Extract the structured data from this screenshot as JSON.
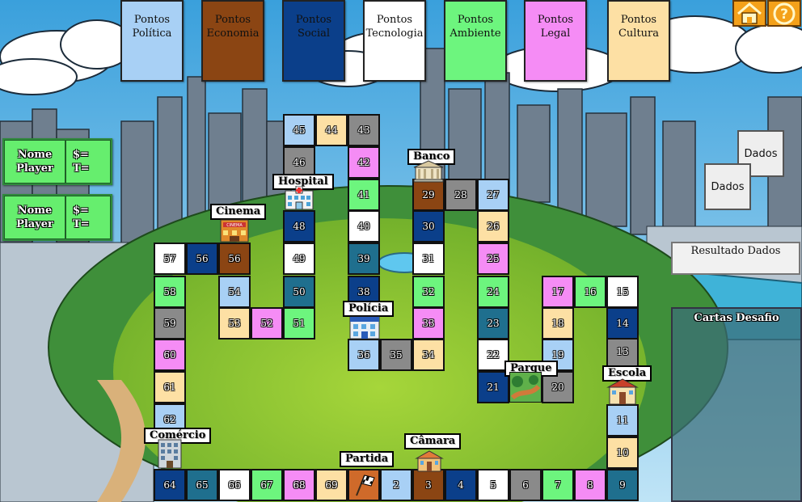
{
  "colors": {
    "politica": "#a8d0f5",
    "economia": "#8b4513",
    "social": "#0b3f8a",
    "tecnologia": "#ffffff",
    "ambiente": "#6df57e",
    "legal": "#f58cf5",
    "cultura": "#fde0a4",
    "button": "#f4a11a",
    "player": "#66ee6e",
    "neutral": "#8a8a8a",
    "teal": "#1f6f8e"
  },
  "points": [
    {
      "line1": "Pontos",
      "line2": "Política",
      "color": "#a8d0f5",
      "text": "#111"
    },
    {
      "line1": "Pontos",
      "line2": "Economia",
      "color": "#8b4513",
      "text": "#111"
    },
    {
      "line1": "Pontos",
      "line2": "Social",
      "color": "#0b3f8a",
      "text": "#111"
    },
    {
      "line1": "Pontos",
      "line2": "Tecnologia",
      "color": "#ffffff",
      "text": "#111"
    },
    {
      "line1": "Pontos",
      "line2": "Ambiente",
      "color": "#6df57e",
      "text": "#111"
    },
    {
      "line1": "Pontos",
      "line2": "Legal",
      "color": "#f58cf5",
      "text": "#111"
    },
    {
      "line1": "Pontos",
      "line2": "Cultura",
      "color": "#fde0a4",
      "text": "#111"
    }
  ],
  "buttons": {
    "home_icon": "house-icon",
    "help_icon": "question-icon"
  },
  "players": [
    {
      "name_line1": "Nome",
      "name_line2": "Player",
      "money": "$=",
      "tokens": "T="
    },
    {
      "name_line1": "Nome",
      "name_line2": "Player",
      "money": "$=",
      "tokens": "T="
    }
  ],
  "places": {
    "banco": "Banco",
    "hospital": "Hospital",
    "cinema": "Cinema",
    "policia": "Polícia",
    "parque": "Parque",
    "escola": "Escola",
    "comercio": "Comércio",
    "camara": "Câmara",
    "partida": "Partida"
  },
  "dice": {
    "die1": "Dados",
    "die2": "Dados",
    "result": "Resultado Dados"
  },
  "challenge": {
    "title": "Cartas Desafio"
  },
  "squares": [
    {
      "n": "2",
      "color": "#a8d0f5"
    },
    {
      "n": "3",
      "color": "#8b4513"
    },
    {
      "n": "4",
      "color": "#0b3f8a"
    },
    {
      "n": "5",
      "color": "#ffffff"
    },
    {
      "n": "6",
      "color": "#8a8a8a"
    },
    {
      "n": "7",
      "color": "#6df57e"
    },
    {
      "n": "8",
      "color": "#f58cf5"
    },
    {
      "n": "9",
      "color": "#1f6f8e"
    },
    {
      "n": "10",
      "color": "#fde0a4"
    },
    {
      "n": "11",
      "color": "#a8d0f5"
    },
    {
      "n": "13",
      "color": "#8a8a8a"
    },
    {
      "n": "14",
      "color": "#0b3f8a"
    },
    {
      "n": "15",
      "color": "#ffffff"
    },
    {
      "n": "16",
      "color": "#6df57e"
    },
    {
      "n": "17",
      "color": "#f58cf5"
    },
    {
      "n": "18",
      "color": "#fde0a4"
    },
    {
      "n": "19",
      "color": "#a8d0f5"
    },
    {
      "n": "20",
      "color": "#8a8a8a"
    },
    {
      "n": "21",
      "color": "#0b3f8a"
    },
    {
      "n": "22",
      "color": "#ffffff"
    },
    {
      "n": "23",
      "color": "#1f6f8e"
    },
    {
      "n": "24",
      "color": "#6df57e"
    },
    {
      "n": "25",
      "color": "#f58cf5"
    },
    {
      "n": "26",
      "color": "#fde0a4"
    },
    {
      "n": "27",
      "color": "#a8d0f5"
    },
    {
      "n": "28",
      "color": "#8a8a8a"
    },
    {
      "n": "29",
      "color": "#8b4513"
    },
    {
      "n": "30",
      "color": "#0b3f8a"
    },
    {
      "n": "31",
      "color": "#ffffff"
    },
    {
      "n": "32",
      "color": "#6df57e"
    },
    {
      "n": "33",
      "color": "#f58cf5"
    },
    {
      "n": "34",
      "color": "#fde0a4"
    },
    {
      "n": "35",
      "color": "#8a8a8a"
    },
    {
      "n": "36",
      "color": "#a8d0f5"
    },
    {
      "n": "38",
      "color": "#0b3f8a"
    },
    {
      "n": "39",
      "color": "#1f6f8e"
    },
    {
      "n": "40",
      "color": "#ffffff"
    },
    {
      "n": "41",
      "color": "#6df57e"
    },
    {
      "n": "42",
      "color": "#f58cf5"
    },
    {
      "n": "43",
      "color": "#8a8a8a"
    },
    {
      "n": "44",
      "color": "#fde0a4"
    },
    {
      "n": "45",
      "color": "#a8d0f5"
    },
    {
      "n": "46",
      "color": "#8a8a8a"
    },
    {
      "n": "48",
      "color": "#0b3f8a"
    },
    {
      "n": "49",
      "color": "#ffffff"
    },
    {
      "n": "50",
      "color": "#1f6f8e"
    },
    {
      "n": "51",
      "color": "#6df57e"
    },
    {
      "n": "52",
      "color": "#f58cf5"
    },
    {
      "n": "53",
      "color": "#fde0a4"
    },
    {
      "n": "54",
      "color": "#a8d0f5"
    },
    {
      "n": "55",
      "color": "#8b4513"
    },
    {
      "n": "56",
      "color": "#0b3f8a"
    },
    {
      "n": "57",
      "color": "#ffffff"
    },
    {
      "n": "58",
      "color": "#6df57e"
    },
    {
      "n": "59",
      "color": "#8a8a8a"
    },
    {
      "n": "60",
      "color": "#f58cf5"
    },
    {
      "n": "61",
      "color": "#fde0a4"
    },
    {
      "n": "62",
      "color": "#a8d0f5"
    },
    {
      "n": "64",
      "color": "#0b3f8a"
    },
    {
      "n": "65",
      "color": "#1f6f8e"
    },
    {
      "n": "66",
      "color": "#ffffff"
    },
    {
      "n": "67",
      "color": "#6df57e"
    },
    {
      "n": "68",
      "color": "#f58cf5"
    },
    {
      "n": "69",
      "color": "#fde0a4"
    }
  ]
}
